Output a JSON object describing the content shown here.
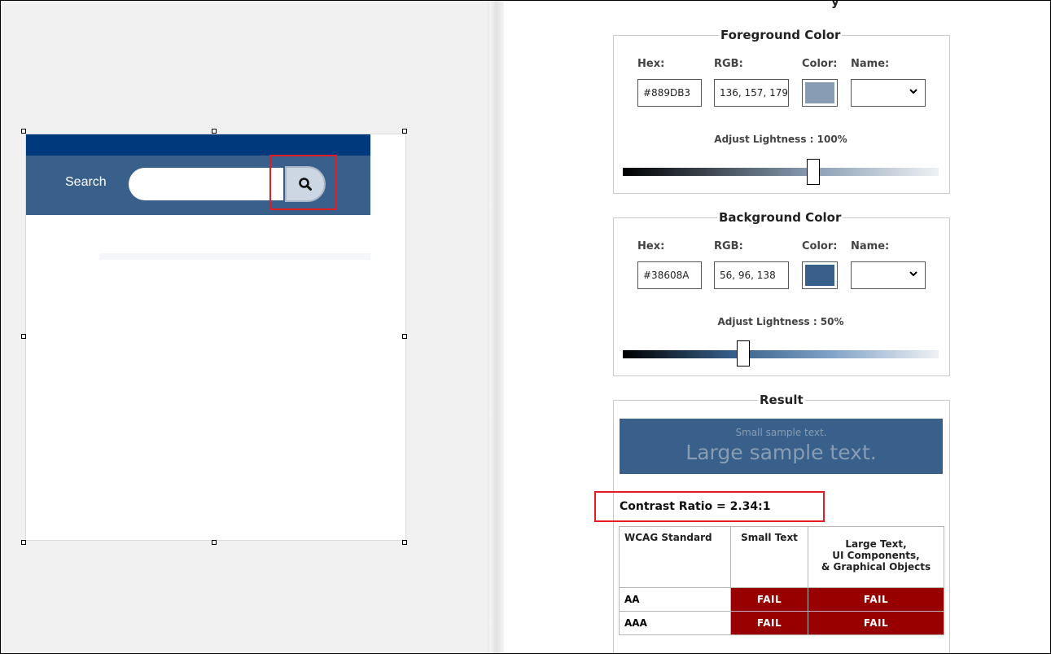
{
  "preview": {
    "search_label": "Search",
    "search_placeholder": "",
    "search_button_icon": "search-icon"
  },
  "foreground": {
    "legend": "Foreground Color",
    "hex_label": "Hex:",
    "rgb_label": "RGB:",
    "color_label": "Color:",
    "name_label": "Name:",
    "hex_value": "#889DB3",
    "rgb_value": "136, 157, 179",
    "swatch_color": "#889db3",
    "name_value": "",
    "adjust_label": "Adjust Lightness : 100%",
    "lightness_percent": 100
  },
  "background": {
    "legend": "Background Color",
    "hex_label": "Hex:",
    "rgb_label": "RGB:",
    "color_label": "Color:",
    "name_label": "Name:",
    "hex_value": "#38608A",
    "rgb_value": "56, 96, 138",
    "swatch_color": "#38608a",
    "name_value": "",
    "adjust_label": "Adjust Lightness : 50%",
    "lightness_percent": 50
  },
  "result": {
    "legend": "Result",
    "small_sample": "Small sample text.",
    "large_sample": "Large sample text.",
    "contrast_ratio": "Contrast Ratio = 2.34:1",
    "table": {
      "headers": [
        "WCAG Standard",
        "Small Text",
        "Large Text,\nUI Components,\n& Graphical Objects"
      ],
      "rows": [
        {
          "standard": "AA",
          "small": "FAIL",
          "large": "FAIL"
        },
        {
          "standard": "AAA",
          "small": "FAIL",
          "large": "FAIL"
        }
      ]
    }
  },
  "colors": {
    "nav_top": "#003a7d",
    "nav_bar": "#38608a",
    "fail": "#980000",
    "highlight": "#e31b23"
  }
}
